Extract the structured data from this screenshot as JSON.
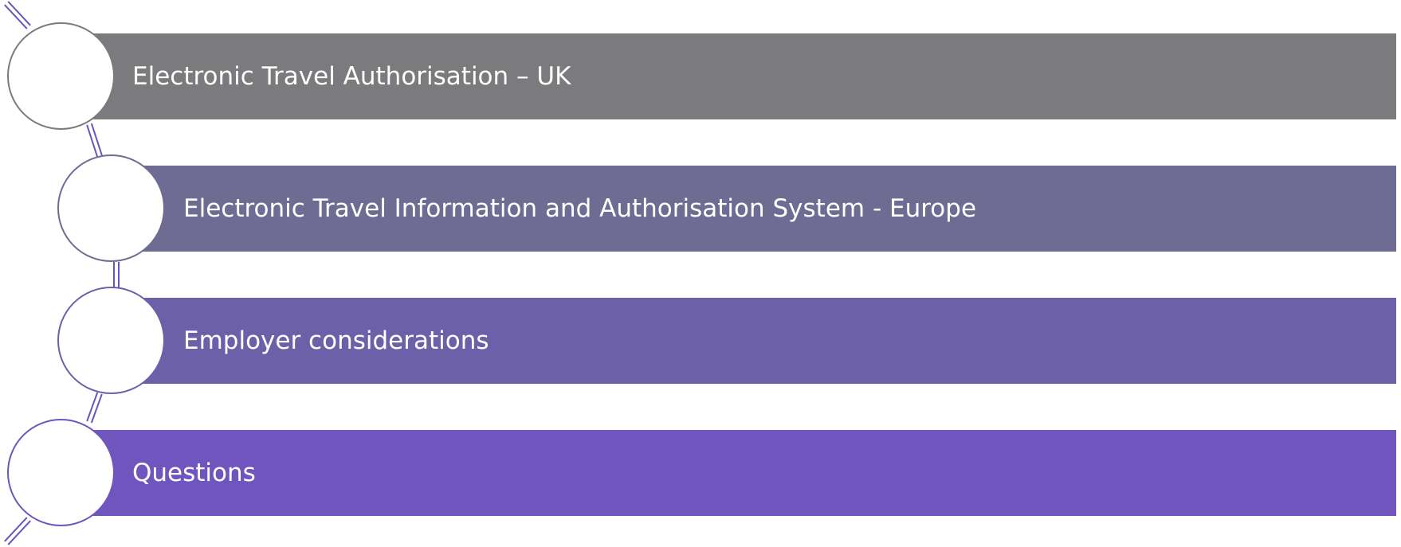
{
  "diagram": {
    "connector_color": "#6a56b8",
    "items": [
      {
        "label": "Electronic Travel Authorisation – UK",
        "color": "#7b7b7d"
      },
      {
        "label": "Electronic Travel Information and Authorisation System - Europe",
        "color": "#6f6c94"
      },
      {
        "label": "Employer considerations",
        "color": "#6c61a8"
      },
      {
        "label": "Questions",
        "color": "#6f55bd"
      }
    ]
  }
}
